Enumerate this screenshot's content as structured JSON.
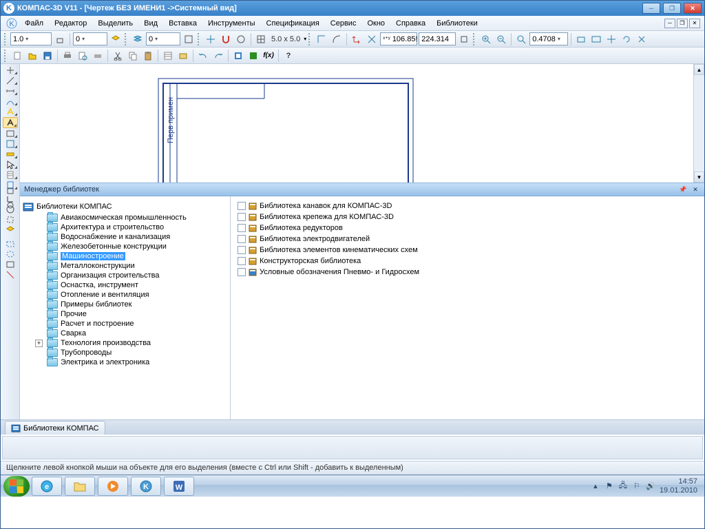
{
  "title": "КОМПАС-3D V11 - [Чертеж БЕЗ ИМЕНИ1 ->Системный вид]",
  "menu": [
    "Файл",
    "Редактор",
    "Выделить",
    "Вид",
    "Вставка",
    "Инструменты",
    "Спецификация",
    "Сервис",
    "Окно",
    "Справка",
    "Библиотеки"
  ],
  "tb1": {
    "scale": "1.0",
    "layer": "0",
    "state": "0"
  },
  "tb2": {
    "grid": "5.0 x 5.0",
    "coordX": "106.85!",
    "coordY": "224.314",
    "zoom": "0.4708"
  },
  "libmgr": {
    "title": "Менеджер библиотек",
    "root": "Библиотеки КОМПАС",
    "folders": [
      "Авиакосмическая промышленность",
      "Архитектура и строительство",
      "Водоснабжение и канализация",
      "Железобетонные конструкции",
      "Машиностроение",
      "Металлоконструкции",
      "Организация строительства",
      "Оснастка, инструмент",
      "Отопление и вентиляция",
      "Примеры библиотек",
      "Прочие",
      "Расчет и построение",
      "Сварка",
      "Технология производства",
      "Трубопроводы",
      "Электрика и электроника"
    ],
    "selected": 4,
    "entries": [
      "Библиотека канавок для КОМПАС-3D",
      "Библиотека крепежа для КОМПАС-3D",
      "Библиотека редукторов",
      "Библиотека электродвигателей",
      "Библиотека элементов кинематических схем",
      "Конструкторская библиотека",
      "Условные обозначения Пневмо- и Гидросхем"
    ],
    "tab": "Библиотеки КОМПАС"
  },
  "status": "Щелкните левой кнопкой мыши на объекте для его выделения (вместе с Ctrl или Shift - добавить к выделенным)",
  "tray": {
    "time": "14:57",
    "date": "19.01.2010"
  }
}
